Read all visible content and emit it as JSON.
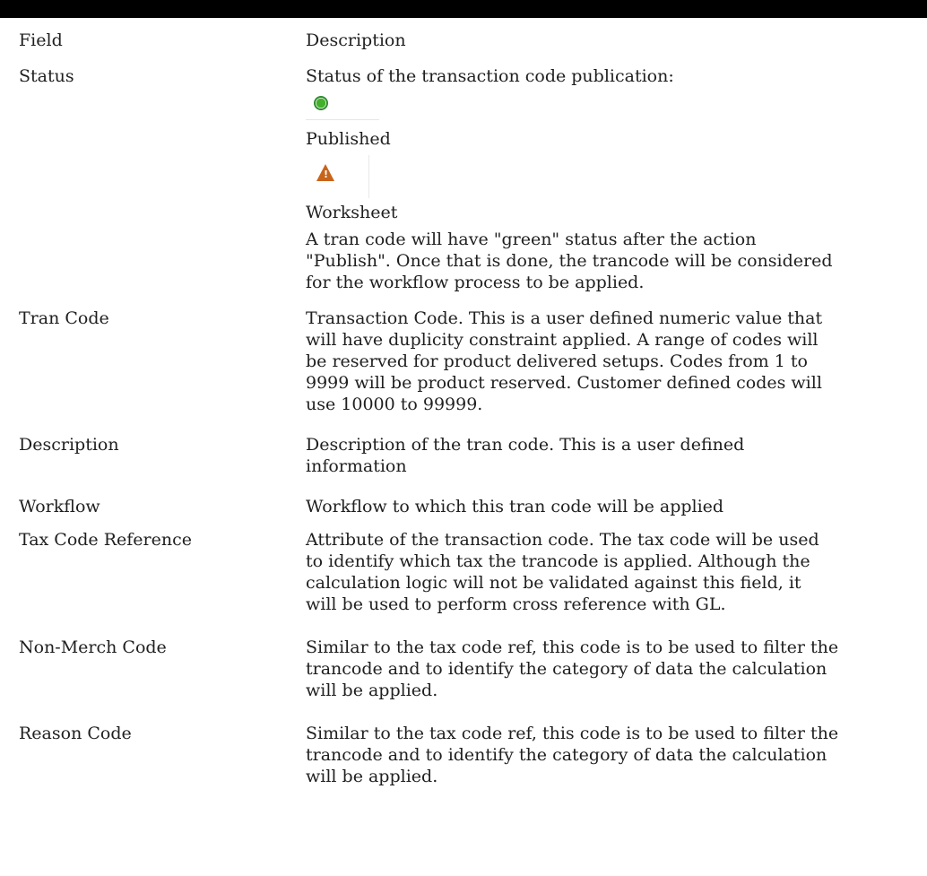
{
  "table": {
    "header": {
      "field": "Field",
      "description": "Description"
    },
    "status": {
      "field": "Status",
      "intro": "Status of the transaction code publication:",
      "published_icon": "green-circle-icon",
      "published_label": "Published",
      "worksheet_icon": "warning-triangle-icon",
      "worksheet_label": "Worksheet",
      "note_lines": [
        "A tran code will have \"green\" status after the action",
        "\"Publish\". Once that is done, the trancode will be considered",
        "for the workflow process to be applied."
      ]
    },
    "rows": [
      {
        "field": "Tran Code",
        "lines": [
          "Transaction Code. This is a user defined numeric value that",
          "will have duplicity constraint applied. A range of codes will",
          "be reserved for product delivered setups. Codes from 1 to",
          "9999 will be product reserved. Customer defined codes will",
          "use 10000 to 99999."
        ]
      },
      {
        "field": "Description",
        "lines": [
          "Description of the tran code. This is a user defined",
          "information"
        ]
      },
      {
        "field": "Workflow",
        "lines": [
          "Workflow to which this tran code will be applied"
        ]
      },
      {
        "field": "Tax Code Reference",
        "lines": [
          "Attribute of the transaction code. The tax code will be used",
          "to identify which tax the trancode is applied. Although the",
          "calculation logic will not be validated against this field, it",
          "will be used to perform cross reference with GL."
        ]
      },
      {
        "field": "Non-Merch Code",
        "lines": [
          "Similar to the tax code ref, this code is to be used to filter the",
          "trancode and to identify the category of data the calculation",
          "will be applied."
        ]
      },
      {
        "field": "Reason Code",
        "lines": [
          "Similar to the tax code ref, this code is to be used to filter the",
          "trancode and to identify the category of data the calculation",
          "will be applied."
        ]
      }
    ]
  }
}
